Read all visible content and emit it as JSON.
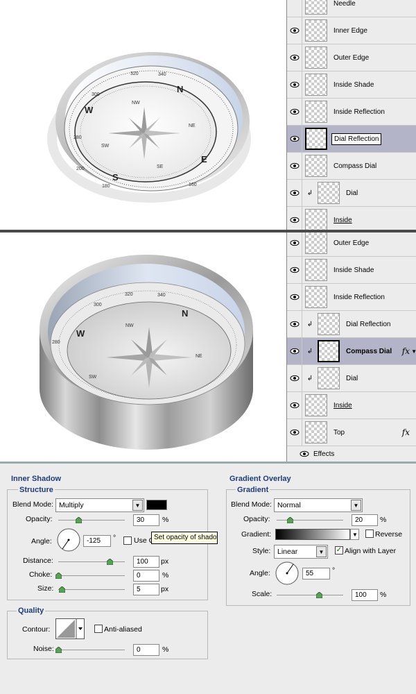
{
  "dial_labels": [
    "320",
    "340",
    "N",
    "NW",
    "NE",
    "SW",
    "SE",
    "S",
    "E",
    "W",
    "280",
    "300",
    "160",
    "180",
    "200"
  ],
  "panel_top": {
    "layers": [
      {
        "name": "Needle",
        "visible": false
      },
      {
        "name": "Inner Edge",
        "visible": true
      },
      {
        "name": "Outer Edge",
        "visible": true
      },
      {
        "name": "Inside Shade",
        "visible": true
      },
      {
        "name": "Inside Reflection",
        "visible": true
      },
      {
        "name": "Dial Reflection",
        "visible": true,
        "selected": true,
        "editing": true
      },
      {
        "name": "Compass Dial",
        "visible": true
      },
      {
        "name": "Dial",
        "visible": true,
        "clipped": true
      },
      {
        "name": "Inside",
        "visible": true,
        "underline": true
      }
    ]
  },
  "panel_bottom": {
    "layers": [
      {
        "name": "Outer Edge",
        "visible": true
      },
      {
        "name": "Inside Shade",
        "visible": true
      },
      {
        "name": "Inside Reflection",
        "visible": true
      },
      {
        "name": "Dial Reflection",
        "visible": true,
        "clipped": true
      },
      {
        "name": "Compass Dial",
        "visible": true,
        "clipped": true,
        "selected": true,
        "bold": true,
        "fx": true
      },
      {
        "name": "Dial",
        "visible": true,
        "clipped": true
      },
      {
        "name": "Inside",
        "visible": true,
        "underline": true
      },
      {
        "name": "Top",
        "visible": true,
        "fx": true
      },
      {
        "name": "Effects",
        "visible": true,
        "sub": true
      }
    ],
    "fx_label": "fx"
  },
  "inner_shadow": {
    "title": "Inner Shadow",
    "structure": "Structure",
    "blend_mode_label": "Blend Mode:",
    "blend_mode": "Multiply",
    "opacity_label": "Opacity:",
    "opacity": "30",
    "angle_label": "Angle:",
    "angle": "-125",
    "use_global_label": "Use G",
    "distance_label": "Distance:",
    "distance": "100",
    "choke_label": "Choke:",
    "choke": "0",
    "size_label": "Size:",
    "size": "5",
    "quality": "Quality",
    "contour_label": "Contour:",
    "anti_aliased_label": "Anti-aliased",
    "noise_label": "Noise:",
    "noise": "0",
    "tooltip": "Set opacity of shadow",
    "pct": "%",
    "px": "px",
    "deg": "°"
  },
  "gradient_overlay": {
    "title": "Gradient Overlay",
    "gradient_section": "Gradient",
    "blend_mode_label": "Blend Mode:",
    "blend_mode": "Normal",
    "opacity_label": "Opacity:",
    "opacity": "20",
    "gradient_label": "Gradient:",
    "reverse_label": "Reverse",
    "style_label": "Style:",
    "style": "Linear",
    "align_label": "Align with Layer",
    "angle_label": "Angle:",
    "angle": "55",
    "scale_label": "Scale:",
    "scale": "100",
    "pct": "%",
    "deg": "°"
  },
  "colors": {
    "accent": "#1e3c7a",
    "selected_row": "#b4b4c8",
    "shadow_color": "#000000"
  }
}
